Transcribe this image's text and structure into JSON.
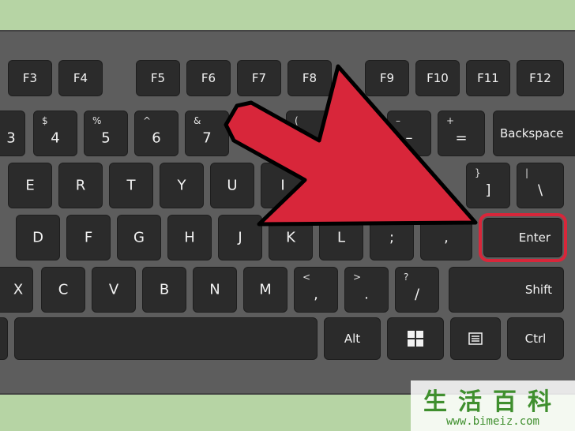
{
  "colors": {
    "background": "#b6d4a4",
    "keyboard": "#5d5d5d",
    "key": "#2b2b2b",
    "key_text": "#f2f2f2",
    "arrow": "#d8263a",
    "highlight": "#d8263a",
    "watermark": "#3f8f2e"
  },
  "rows": {
    "function": [
      "F3",
      "F4",
      "F5",
      "F6",
      "F7",
      "F8",
      "F9",
      "F10",
      "F11",
      "F12"
    ],
    "number": [
      {
        "sub": "",
        "main": "3"
      },
      {
        "sub": "$",
        "main": "4"
      },
      {
        "sub": "%",
        "main": "5"
      },
      {
        "sub": "^",
        "main": "6"
      },
      {
        "sub": "&",
        "main": "7"
      },
      {
        "sub": "(",
        "main": ""
      },
      {
        "sub": "",
        "main": ""
      },
      {
        "sub": "–",
        "main": "–"
      },
      {
        "sub": "+",
        "main": "="
      },
      {
        "sub": "",
        "main": "Backspace"
      }
    ],
    "top": [
      {
        "sub": "",
        "main": "E"
      },
      {
        "sub": "",
        "main": "R"
      },
      {
        "sub": "",
        "main": "T"
      },
      {
        "sub": "",
        "main": "Y"
      },
      {
        "sub": "",
        "main": "U"
      },
      {
        "sub": "",
        "main": "I"
      },
      {
        "sub": "",
        "main": ""
      },
      {
        "sub": "",
        "main": ""
      },
      {
        "sub": "}",
        "main": "]"
      },
      {
        "sub": "|",
        "main": "\\"
      }
    ],
    "home": [
      {
        "sub": "",
        "main": "D"
      },
      {
        "sub": "",
        "main": "F"
      },
      {
        "sub": "",
        "main": "G"
      },
      {
        "sub": "",
        "main": "H"
      },
      {
        "sub": "",
        "main": "J"
      },
      {
        "sub": "",
        "main": "K"
      },
      {
        "sub": "",
        "main": "L"
      },
      {
        "sub": "",
        "main": ";"
      },
      {
        "sub": "",
        "main": ","
      },
      {
        "sub": "",
        "main": "Enter"
      }
    ],
    "bottom": [
      {
        "sub": "",
        "main": "X"
      },
      {
        "sub": "",
        "main": "C"
      },
      {
        "sub": "",
        "main": "V"
      },
      {
        "sub": "",
        "main": "B"
      },
      {
        "sub": "",
        "main": "N"
      },
      {
        "sub": "",
        "main": "M"
      },
      {
        "sub": "<",
        "main": ","
      },
      {
        "sub": ">",
        "main": "."
      },
      {
        "sub": "?",
        "main": "/"
      },
      {
        "sub": "",
        "main": "Shift"
      }
    ],
    "space": [
      {
        "sub": "",
        "main": ""
      },
      {
        "sub": "",
        "main": ""
      },
      {
        "sub": "",
        "main": "Alt"
      },
      {
        "sub": "",
        "main": "",
        "icon": "windows-icon"
      },
      {
        "sub": "",
        "main": "",
        "icon": "menu-icon"
      },
      {
        "sub": "",
        "main": "Ctrl"
      }
    ]
  },
  "watermark": {
    "chinese": "生活百科",
    "url": "www.bimeiz.com"
  }
}
